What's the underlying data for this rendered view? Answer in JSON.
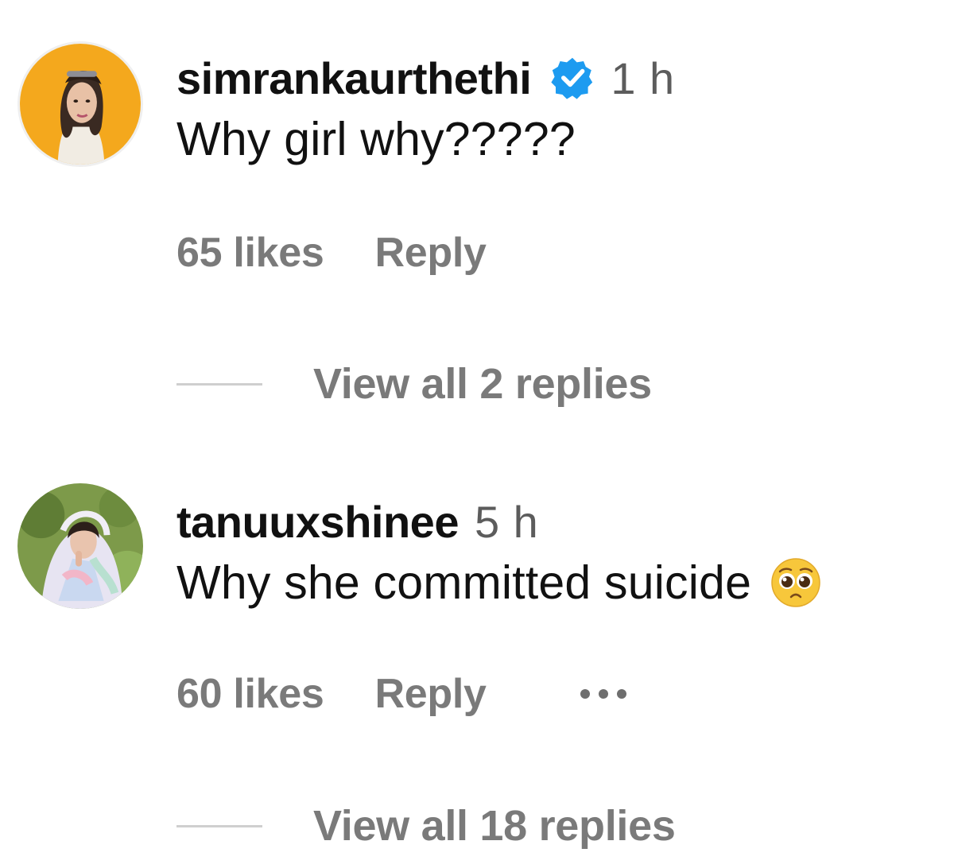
{
  "comments": [
    {
      "username": "simrankaurthethi",
      "verified": true,
      "time": "1 h",
      "text": "Why girl why?????",
      "likes": "65 likes",
      "reply_label": "Reply",
      "view_replies": "View all 2 replies"
    },
    {
      "username": "tanuuxshinee",
      "verified": false,
      "time": "5 h",
      "text": "Why she committed suicide",
      "emoji": "pleading-face-icon",
      "likes": "60 likes",
      "reply_label": "Reply",
      "more": "more-options-icon",
      "view_replies": "View all 18 replies"
    }
  ],
  "colors": {
    "verified": "#1d9bf0",
    "muted": "#7a7a7a",
    "avatar_1_bg": "#f5a623"
  }
}
